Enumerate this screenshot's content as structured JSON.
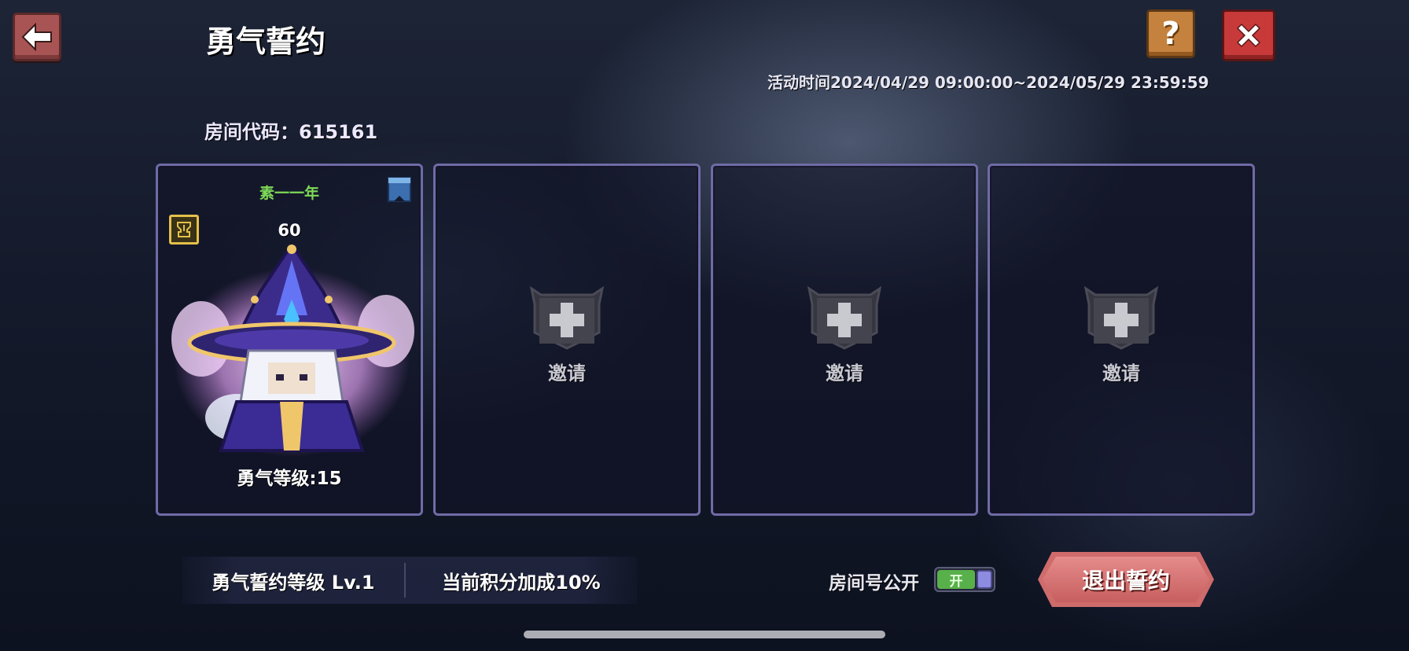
{
  "header": {
    "title": "勇气誓约",
    "back_icon": "arrow-left-icon",
    "help_label": "?",
    "close_icon": "close-x-icon"
  },
  "event_time": "活动时间2024/04/29 09:00:00~2024/05/29 23:59:59",
  "room_code": "房间代码：615161",
  "slots": [
    {
      "player_name": "素一一年",
      "level": "60",
      "courage_level": "勇气等级:15",
      "rank_icon": "trophy-icon",
      "bookmark_icon": "banner-icon"
    },
    {
      "invite_label": "邀请"
    },
    {
      "invite_label": "邀请"
    },
    {
      "invite_label": "邀请"
    }
  ],
  "bottom": {
    "oath_level": "勇气誓约等级 Lv.1",
    "score_bonus": "当前积分加成10%",
    "room_public_label": "房间号公开",
    "toggle_label": "开",
    "toggle_on": true,
    "exit_button": "退出誓约"
  },
  "colors": {
    "player_name": "#7ed957",
    "card_border": "#6f6ba6",
    "exit_button": "#cf6b6b",
    "toggle_on": "#58b04a"
  }
}
